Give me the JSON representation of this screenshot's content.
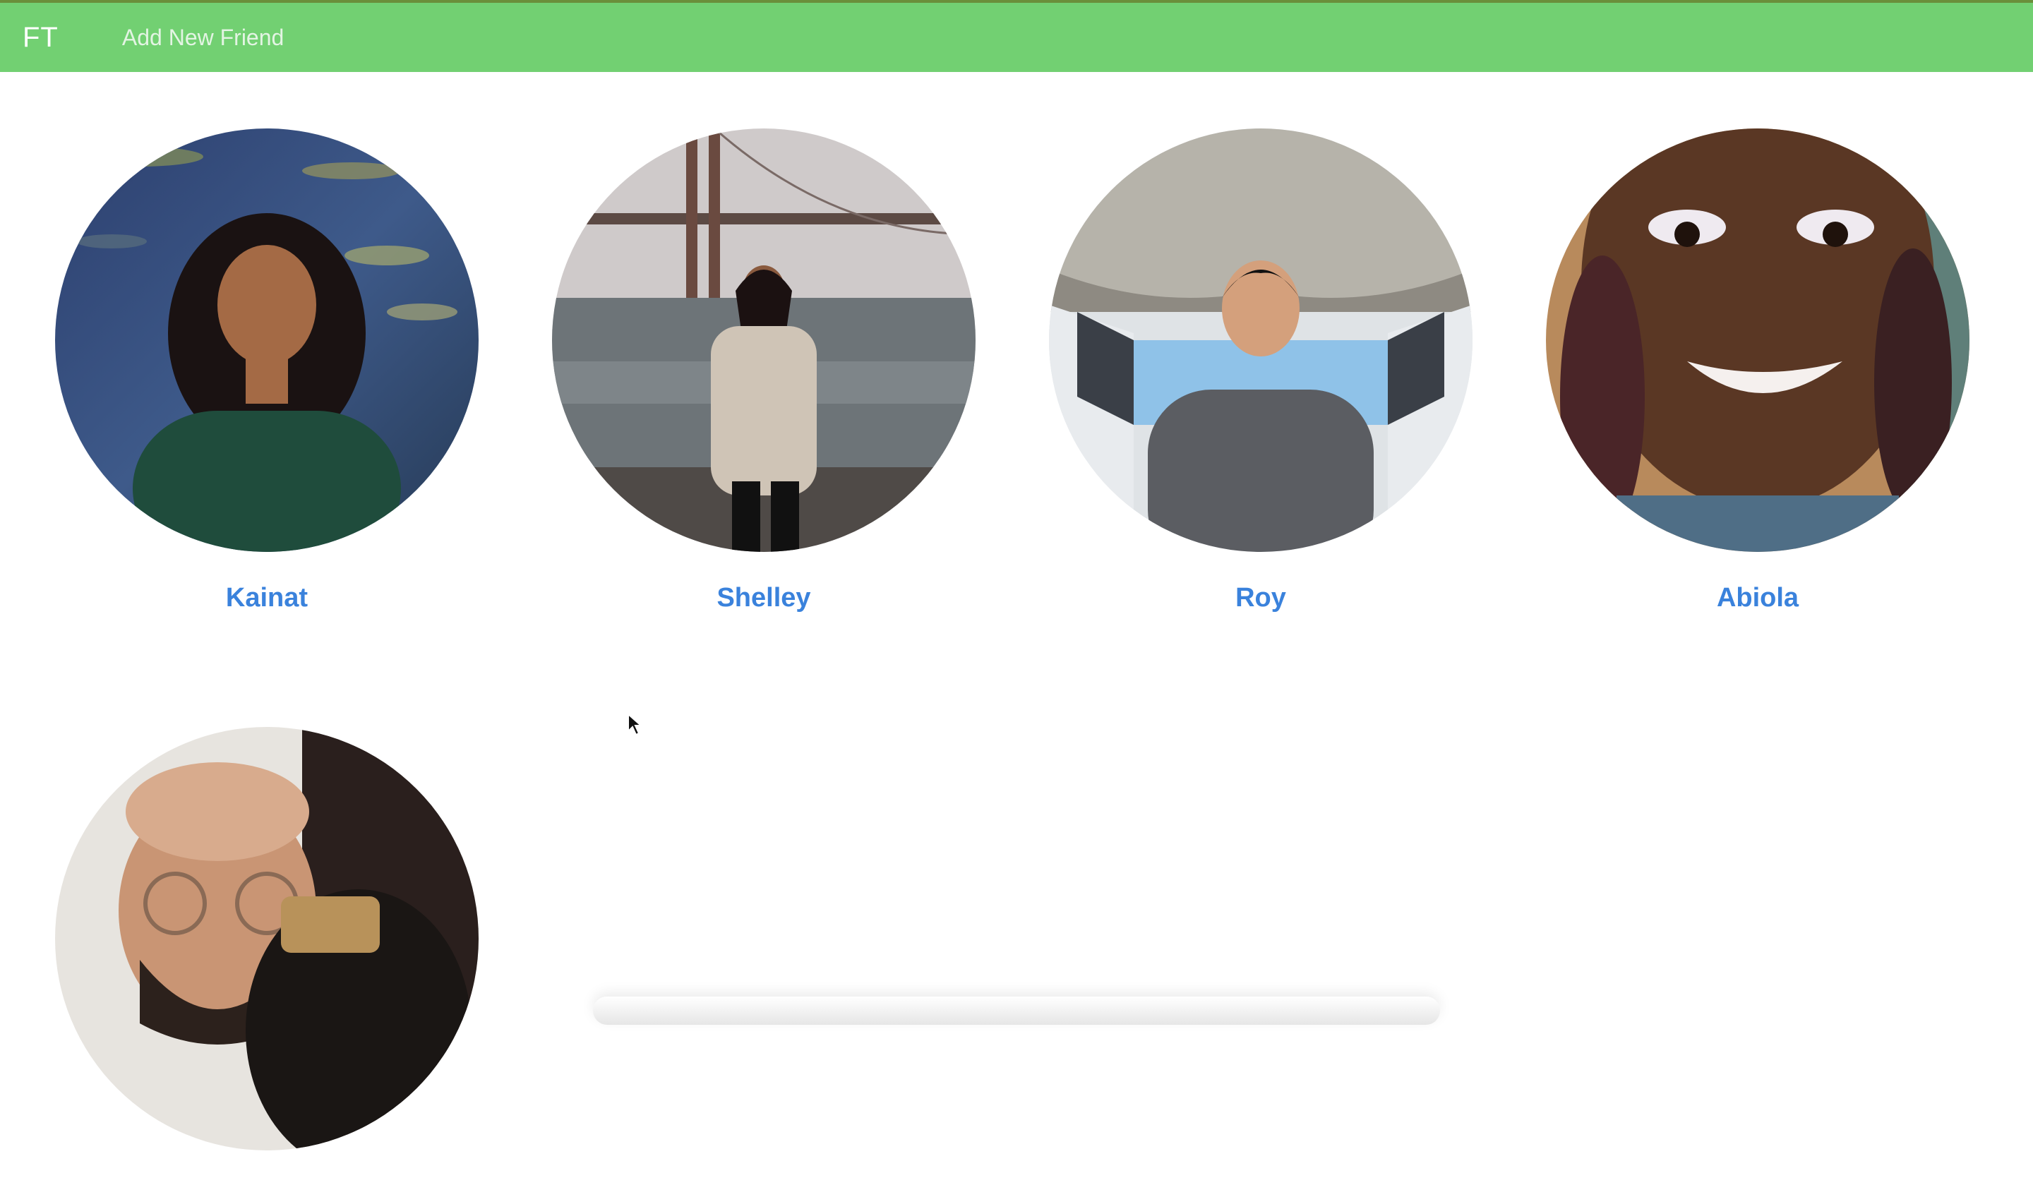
{
  "navbar": {
    "brand": "FT",
    "add_friend_label": "Add New Friend",
    "color": "#72d072"
  },
  "friends": [
    {
      "name": "Kainat"
    },
    {
      "name": "Shelley"
    },
    {
      "name": "Roy"
    },
    {
      "name": "Abiola"
    },
    {
      "name": ""
    }
  ],
  "colors": {
    "link": "#3a82dc"
  }
}
